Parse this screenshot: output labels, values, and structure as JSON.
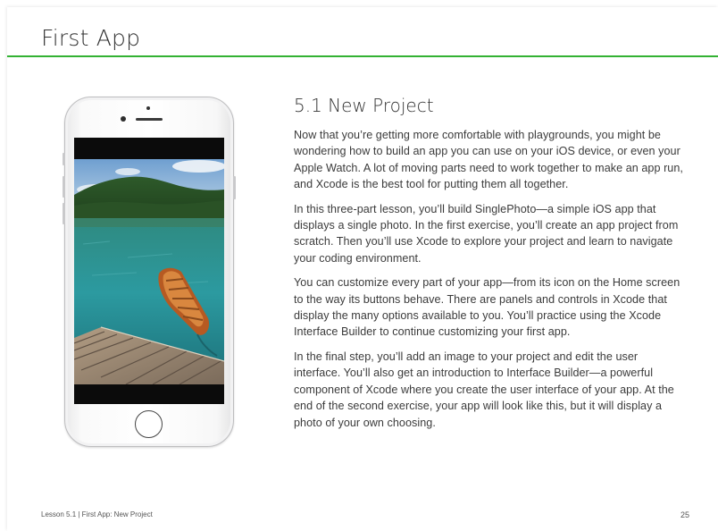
{
  "header": {
    "title": "First App"
  },
  "content": {
    "section_title": "5.1 New Project",
    "paragraphs": [
      "Now that you’re getting more comfortable with playgrounds, you might be wondering how to build an app you can use on your iOS device, or even your Apple Watch. A lot of moving parts need to work together to make an app run, and Xcode is the best tool for putting them all together.",
      "In this three-part lesson, you’ll build SinglePhoto—a simple iOS app that displays a single photo. In the first exercise, you’ll create an app project from scratch. Then you’ll use Xcode to explore your project and learn to navigate your coding environment.",
      "You can customize every part of your app—from its icon on the Home screen to the way its buttons behave. There are panels and controls in Xcode that display the many options available to you. You’ll practice using the Xcode Interface Builder to continue customizing your first app.",
      "In the final step, you’ll add an image to your project and edit the user interface. You’ll also get an introduction to Interface Builder—a powerful component of Xcode where you create the user interface of your app. At the end of the second exercise, your app will look like this, but it will display a photo of your own choosing."
    ]
  },
  "footer": {
    "left": "Lesson 5.1  |  First App: New Project",
    "page_number": "25"
  },
  "colors": {
    "accent_rule": "#33b233"
  }
}
